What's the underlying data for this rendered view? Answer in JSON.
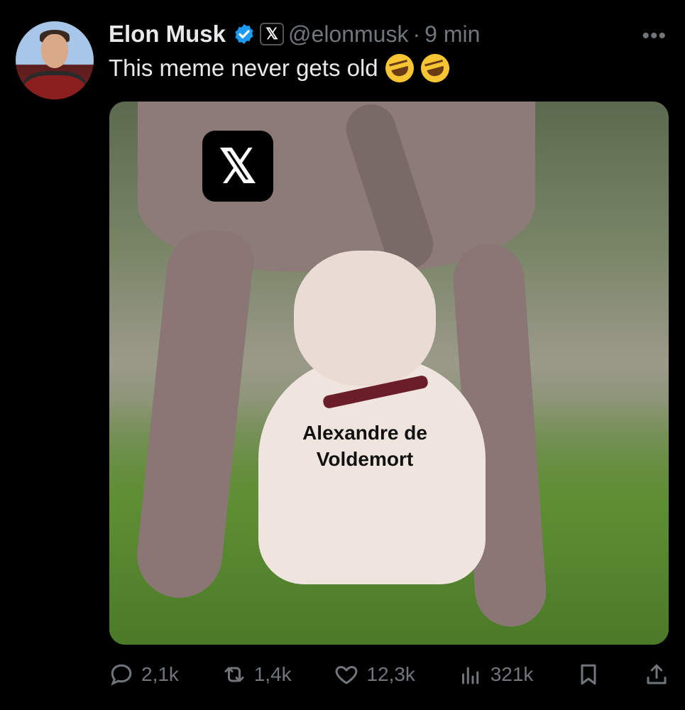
{
  "tweet": {
    "author_name": "Elon Musk",
    "handle": "@elonmusk",
    "separator": "·",
    "time": "9 min",
    "affiliation_badge": "𝕏",
    "more_label": "•••",
    "text": "This meme never gets old",
    "emojis": [
      "rolling-on-floor-laughing",
      "rolling-on-floor-laughing"
    ]
  },
  "media": {
    "logo_label": "𝕏",
    "caption_line1": "Alexandre de",
    "caption_line2": "Voldemort"
  },
  "actions": {
    "replies": "2,1k",
    "reposts": "1,4k",
    "likes": "12,3k",
    "views": "321k"
  },
  "colors": {
    "background": "#000000",
    "text_primary": "#e7e9ea",
    "text_secondary": "#71767b",
    "verified_blue": "#1d9bf0"
  }
}
